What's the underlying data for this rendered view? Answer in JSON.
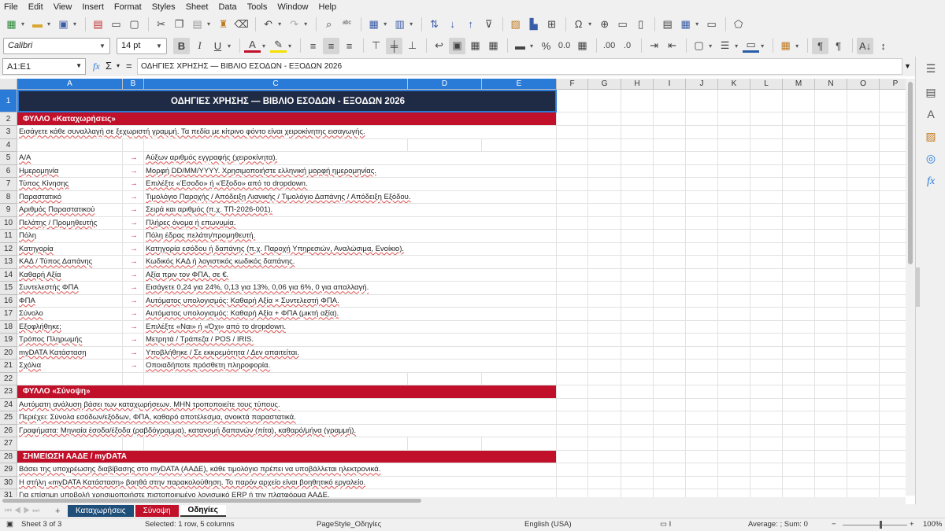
{
  "menu": [
    "File",
    "Edit",
    "View",
    "Insert",
    "Format",
    "Styles",
    "Sheet",
    "Data",
    "Tools",
    "Window",
    "Help"
  ],
  "toolbar2": {
    "font_name": "Calibri",
    "font_size": "14 pt"
  },
  "formula_bar": {
    "name_box": "A1:E1",
    "content": "ΟΔΗΓΙΕΣ ΧΡΗΣΗΣ — ΒΙΒΛΙΟ ΕΣΟΔΩΝ - ΕΞΟΔΩΝ 2026"
  },
  "columns": [
    "A",
    "B",
    "C",
    "D",
    "E",
    "F",
    "G",
    "H",
    "I",
    "J",
    "K",
    "L",
    "M",
    "N",
    "O",
    "P"
  ],
  "rows": [
    {
      "n": "1",
      "type": "title",
      "text": "ΟΔΗΓΙΕΣ ΧΡΗΣΗΣ — ΒΙΒΛΙΟ ΕΣΟΔΩΝ - ΕΞΟΔΩΝ 2026"
    },
    {
      "n": "2",
      "type": "section",
      "text": "ΦΥΛΛΟ «Καταχωρήσεις»"
    },
    {
      "n": "3",
      "type": "text",
      "text": "Εισάγετε κάθε συναλλαγή σε ξεχωριστή γραμμή. Τα πεδία με κίτρινο φόντο είναι χειροκίνητης εισαγωγής."
    },
    {
      "n": "4",
      "type": "blank"
    },
    {
      "n": "5",
      "type": "field",
      "field": "Α/Α",
      "arrow": "→",
      "desc": "Αύξων αριθμός εγγραφής (χειροκίνητα)."
    },
    {
      "n": "6",
      "type": "field",
      "field": "Ημερομηνία",
      "arrow": "→",
      "desc": "Μορφή DD/MM/YYYY. Χρησιμοποιήστε ελληνική μορφή ημερομηνίας."
    },
    {
      "n": "7",
      "type": "field",
      "field": "Τύπος Κίνησης",
      "arrow": "→",
      "desc": "Επιλέξτε «Έσοδο» ή «Έξοδο» από το dropdown."
    },
    {
      "n": "8",
      "type": "field",
      "field": "Παραστατικό",
      "arrow": "→",
      "desc": "Τιμολόγιο Παροχής / Απόδειξη Λιανικής / Τιμολόγιο Δαπάνης / Απόδειξη Εξόδου."
    },
    {
      "n": "9",
      "type": "field",
      "field": "Αριθμός Παραστατικού",
      "arrow": "→",
      "desc": "Σειρά και αριθμός (π.χ. ΤΠ-2026-001)."
    },
    {
      "n": "10",
      "type": "field",
      "field": "Πελάτης / Προμηθευτής",
      "arrow": "→",
      "desc": "Πλήρες όνομα ή επωνυμία."
    },
    {
      "n": "11",
      "type": "field",
      "field": "Πόλη",
      "arrow": "→",
      "desc": "Πόλη έδρας πελάτη/προμηθευτή."
    },
    {
      "n": "12",
      "type": "field",
      "field": "Κατηγορία",
      "arrow": "→",
      "desc": "Κατηγορία εσόδου ή δαπάνης (π.χ. Παροχή Υπηρεσιών, Αναλώσιμα, Ενοίκιο)."
    },
    {
      "n": "13",
      "type": "field",
      "field": "ΚΑΔ / Τύπος Δαπάνης",
      "arrow": "→",
      "desc": "Κωδικός ΚΑΔ ή λογιστικός κωδικός δαπάνης."
    },
    {
      "n": "14",
      "type": "field",
      "field": "Καθαρή Αξία",
      "arrow": "→",
      "desc": "Αξία πριν τον ΦΠΑ, σε €."
    },
    {
      "n": "15",
      "type": "field",
      "field": "Συντελεστής ΦΠΑ",
      "arrow": "→",
      "desc": "Εισάγετε 0,24 για 24%, 0,13 για 13%, 0,06 για 6%, 0 για απαλλαγή."
    },
    {
      "n": "16",
      "type": "field",
      "field": "ΦΠΑ",
      "arrow": "→",
      "desc": "Αυτόματος υπολογισμός: Καθαρή Αξία × Συντελεστή ΦΠΑ."
    },
    {
      "n": "17",
      "type": "field",
      "field": "Σύνολο",
      "arrow": "→",
      "desc": "Αυτόματος υπολογισμός: Καθαρή Αξία + ΦΠΑ (μικτή αξία)."
    },
    {
      "n": "18",
      "type": "field",
      "field": "Εξοφλήθηκε;",
      "arrow": "→",
      "desc": "Επιλέξτε «Ναι» ή «Όχι» από το dropdown."
    },
    {
      "n": "19",
      "type": "field",
      "field": "Τρόπος Πληρωμής",
      "arrow": "→",
      "desc": "Μετρητά / Τράπεζα / POS / IRIS."
    },
    {
      "n": "20",
      "type": "field",
      "field": "myDATA Κατάσταση",
      "arrow": "→",
      "desc": "Υποβλήθηκε / Σε εκκρεμότητα / Δεν απαιτείται."
    },
    {
      "n": "21",
      "type": "field",
      "field": "Σχόλια",
      "arrow": "→",
      "desc": "Οποιαδήποτε πρόσθετη πληροφορία."
    },
    {
      "n": "22",
      "type": "blank"
    },
    {
      "n": "23",
      "type": "section",
      "text": "ΦΥΛΛΟ «Σύνοψη»"
    },
    {
      "n": "24",
      "type": "text",
      "text": "Αυτόματη ανάλυση βάσει των καταχωρήσεων. ΜΗΝ τροποποιείτε τους τύπους."
    },
    {
      "n": "25",
      "type": "text",
      "text": "Περιέχει: Σύνολα εσόδων/εξόδων, ΦΠΑ, καθαρό αποτέλεσμα, ανοικτά παραστατικά."
    },
    {
      "n": "26",
      "type": "text",
      "text": "Γραφήματα: Μηνιαία έσοδα/έξοδα (ραβδόγραμμα), κατανομή δαπανών (πίτα), καθαρό/μήνα (γραμμή)."
    },
    {
      "n": "27",
      "type": "blank"
    },
    {
      "n": "28",
      "type": "section",
      "text": "ΣΗΜΕΙΩΣΗ ΑΑΔΕ / myDATA"
    },
    {
      "n": "29",
      "type": "text",
      "text": "Βάσει της υποχρέωσης διαβίβασης στο myDATA (ΑΑΔΕ), κάθε τιμολόγιο πρέπει να υποβάλλεται ηλεκτρονικά."
    },
    {
      "n": "30",
      "type": "text",
      "text": "Η στήλη «myDATA Κατάσταση» βοηθά στην παρακολούθηση. Το παρόν αρχείο είναι βοηθητικό εργαλείο."
    },
    {
      "n": "31",
      "type": "text",
      "text": "Για επίσημη υποβολή χρησιμοποιήστε πιστοποιημένο λογισμικό ERP ή την πλατφόρμα ΑΑΔΕ."
    }
  ],
  "sheet_tabs": [
    {
      "label": "Καταχωρήσεις",
      "bg": "#1f4e79",
      "fg": "#ffffff"
    },
    {
      "label": "Σύνοψη",
      "bg": "#c0102a",
      "fg": "#ffffff"
    },
    {
      "label": "Οδηγίες",
      "bg": "#ffffff",
      "fg": "#000000"
    }
  ],
  "status": {
    "sheet": "Sheet 3 of 3",
    "selection": "Selected: 1 row, 5 columns",
    "page_style": "PageStyle_Οδηγίες",
    "language": "English (USA)",
    "calc": "Average: ; Sum: 0",
    "zoom": "100%"
  },
  "colors": {
    "title_bg": "#1f2a44",
    "section_bg": "#c0102a",
    "arrow": "#c0102a",
    "selection": "#2a7ad8"
  }
}
